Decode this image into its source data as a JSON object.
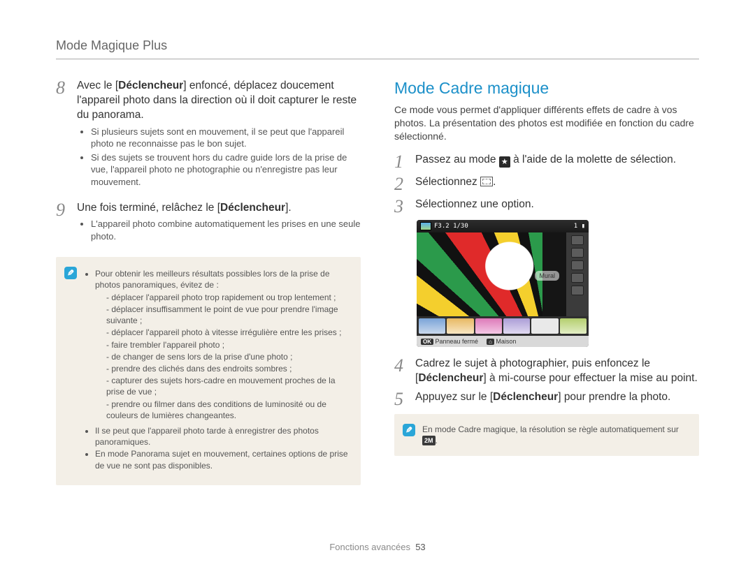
{
  "header": {
    "title": "Mode Magique Plus"
  },
  "footer": {
    "section": "Fonctions avancées",
    "page": "53"
  },
  "left": {
    "step8": {
      "num": "8",
      "text_pre": "Avec le [",
      "text_bold": "Déclencheur",
      "text_post": "] enfoncé, déplacez doucement l'appareil photo dans la direction où il doit capturer le reste du panorama.",
      "bullets": [
        "Si plusieurs sujets sont en mouvement, il se peut que l'appareil photo ne reconnaisse pas le bon sujet.",
        "Si des sujets se trouvent hors du cadre guide lors de la prise de vue, l'appareil photo ne photographie ou n'enregistre pas leur mouvement."
      ]
    },
    "step9": {
      "num": "9",
      "text_pre": "Une fois terminé, relâchez le [",
      "text_bold": "Déclencheur",
      "text_post": "].",
      "bullets": [
        "L'appareil photo combine automatiquement les prises en une seule photo."
      ]
    },
    "note": {
      "lead_bullet": "Pour obtenir les meilleurs résultats possibles lors de la prise de photos panoramiques, évitez de :",
      "dashes": [
        "déplacer l'appareil photo trop rapidement ou trop lentement ;",
        "déplacer insuffisamment le point de vue pour prendre l'image suivante ;",
        "déplacer l'appareil photo à vitesse irrégulière entre les prises ;",
        "faire trembler l'appareil photo ;",
        "de changer de sens lors de la prise d'une photo ;",
        "prendre des clichés dans des endroits sombres ;",
        "capturer des sujets hors-cadre en mouvement proches de la prise de vue ;",
        "prendre ou filmer dans des conditions de luminosité ou de couleurs de lumières changeantes."
      ],
      "extra_bullets": [
        "Il se peut que l'appareil photo tarde à enregistrer des photos panoramiques.",
        "En mode Panorama sujet en mouvement, certaines options de prise de vue ne sont pas disponibles."
      ]
    }
  },
  "right": {
    "heading": "Mode Cadre magique",
    "intro": "Ce mode vous permet d'appliquer différents effets de cadre à vos photos. La présentation des photos est modifiée en fonction du cadre sélectionné.",
    "step1": {
      "num": "1",
      "pre": "Passez au mode ",
      "post": " à l'aide de la molette de sélection."
    },
    "step2": {
      "num": "2",
      "pre": "Sélectionnez ",
      "post": "."
    },
    "step3": {
      "num": "3",
      "text": "Sélectionnez une option."
    },
    "camera": {
      "top_left": "F3.2 1/30",
      "top_right_battery": "1",
      "label": "Mural",
      "ok_key": "OK",
      "ok_text": "Panneau fermé",
      "home_key": "⌂",
      "home_text": "Maison",
      "res_badge": "2M"
    },
    "step4": {
      "num": "4",
      "pre": "Cadrez le sujet à photographier, puis enfoncez le [",
      "bold": "Déclencheur",
      "post": "] à mi-course pour effectuer la mise au point."
    },
    "step5": {
      "num": "5",
      "pre": "Appuyez sur le [",
      "bold": "Déclencheur",
      "post": "] pour prendre la photo."
    },
    "note": {
      "text_pre": "En mode Cadre magique, la résolution se règle automatiquement sur ",
      "res_badge": "2M",
      "text_post": "."
    }
  }
}
